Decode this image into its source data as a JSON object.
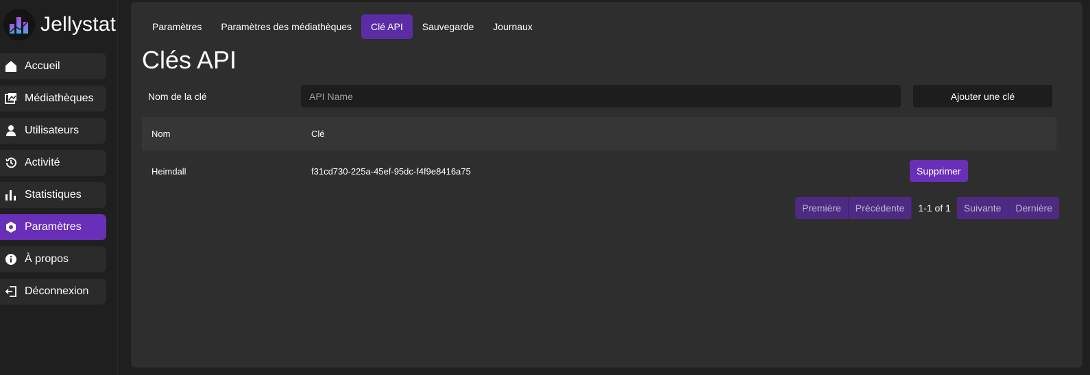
{
  "app": {
    "name": "Jellystat"
  },
  "sidebar": {
    "items": [
      {
        "label": "Accueil",
        "icon": "home-icon",
        "active": false
      },
      {
        "label": "Médiathèques",
        "icon": "library-icon",
        "active": false
      },
      {
        "label": "Utilisateurs",
        "icon": "user-icon",
        "active": false
      },
      {
        "label": "Activité",
        "icon": "history-icon",
        "active": false
      },
      {
        "label": "Statistiques",
        "icon": "bar-chart-icon",
        "active": false
      },
      {
        "label": "Paramètres",
        "icon": "settings-hexagon-icon",
        "active": true
      },
      {
        "label": "À propos",
        "icon": "info-icon",
        "active": false
      },
      {
        "label": "Déconnexion",
        "icon": "logout-icon",
        "active": false
      }
    ]
  },
  "tabs": [
    {
      "label": "Paramètres",
      "active": false
    },
    {
      "label": "Paramètres des médiathèques",
      "active": false
    },
    {
      "label": "Clé API",
      "active": true
    },
    {
      "label": "Sauvegarde",
      "active": false
    },
    {
      "label": "Journaux",
      "active": false
    }
  ],
  "page": {
    "title": "Clés API"
  },
  "form": {
    "label": "Nom de la clé",
    "input_value": "",
    "input_placeholder": "API Name",
    "add_label": "Ajouter une clé"
  },
  "table": {
    "headers": {
      "name": "Nom",
      "key": "Clé"
    },
    "rows": [
      {
        "name": "Heimdall",
        "key": "f31cd730-225a-45ef-95dc-f4f9e8416a75",
        "action": "Supprimer"
      }
    ]
  },
  "pagination": {
    "first": "Première",
    "prev": "Précédente",
    "info": "1-1 of 1",
    "next": "Suivante",
    "last": "Dernière"
  },
  "colors": {
    "accent": "#6a2fb8",
    "background": "#1f1f1f",
    "panel": "#2e2e2e"
  }
}
